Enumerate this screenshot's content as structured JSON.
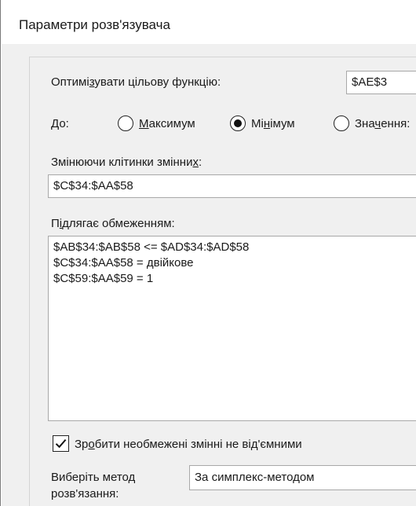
{
  "window": {
    "title": "Параметри розв'язувача"
  },
  "objective": {
    "label_pre": "Оптимі",
    "label_u": "з",
    "label_post": "увати цільову функцію:",
    "value": "$AE$3"
  },
  "target": {
    "label": "До:",
    "options": [
      {
        "pre": "",
        "u": "М",
        "post": "аксимум",
        "selected": false
      },
      {
        "pre": "Мі",
        "u": "н",
        "post": "імум",
        "selected": true
      },
      {
        "pre": "Зна",
        "u": "ч",
        "post": "ення:",
        "selected": false
      }
    ]
  },
  "variables": {
    "label_pre": "Змінюючи клітинки змінни",
    "label_u": "х",
    "label_post": ":",
    "value": "$C$34:$AA$58"
  },
  "constraints": {
    "label_pre": "П",
    "label_u": "і",
    "label_post": "длягає обмеженням:",
    "items": [
      "$AB$34:$AB$58 <= $AD$34:$AD$58",
      "$C$34:$AA$58 = двійкове",
      "$C$59:$AA$59 = 1"
    ]
  },
  "nonnegative": {
    "checked": true,
    "label_pre": "Зр",
    "label_u": "о",
    "label_post": "бити необмежені змінні не від'ємними"
  },
  "method": {
    "label_line1": "Виберіть метод",
    "label_line2": "розв'язання:",
    "value": "За симплекс-методом"
  }
}
